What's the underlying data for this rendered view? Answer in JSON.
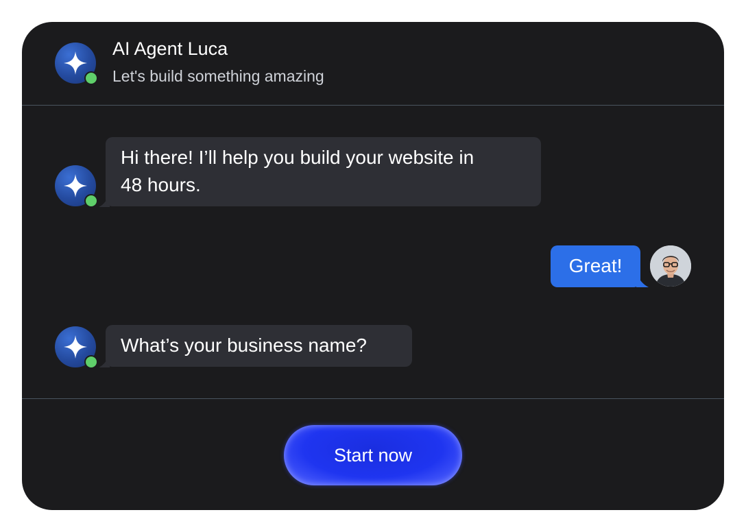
{
  "header": {
    "title": "AI Agent Luca",
    "subtitle": "Let's build something amazing",
    "avatar_icon": "sparkle-icon",
    "status": "online"
  },
  "messages": [
    {
      "sender": "agent",
      "text_line1": "Hi there! I’ll help you build your website in",
      "text_line2": "48 hours."
    },
    {
      "sender": "user",
      "text": "Great!"
    },
    {
      "sender": "agent",
      "text": "What’s your business name?"
    }
  ],
  "cta": {
    "label": "Start now"
  },
  "colors": {
    "background": "#1b1b1d",
    "agent_bubble": "#2e2f35",
    "user_bubble": "#2c6fe8",
    "online_dot": "#5fcf6a",
    "cta": "#1f35f0"
  }
}
